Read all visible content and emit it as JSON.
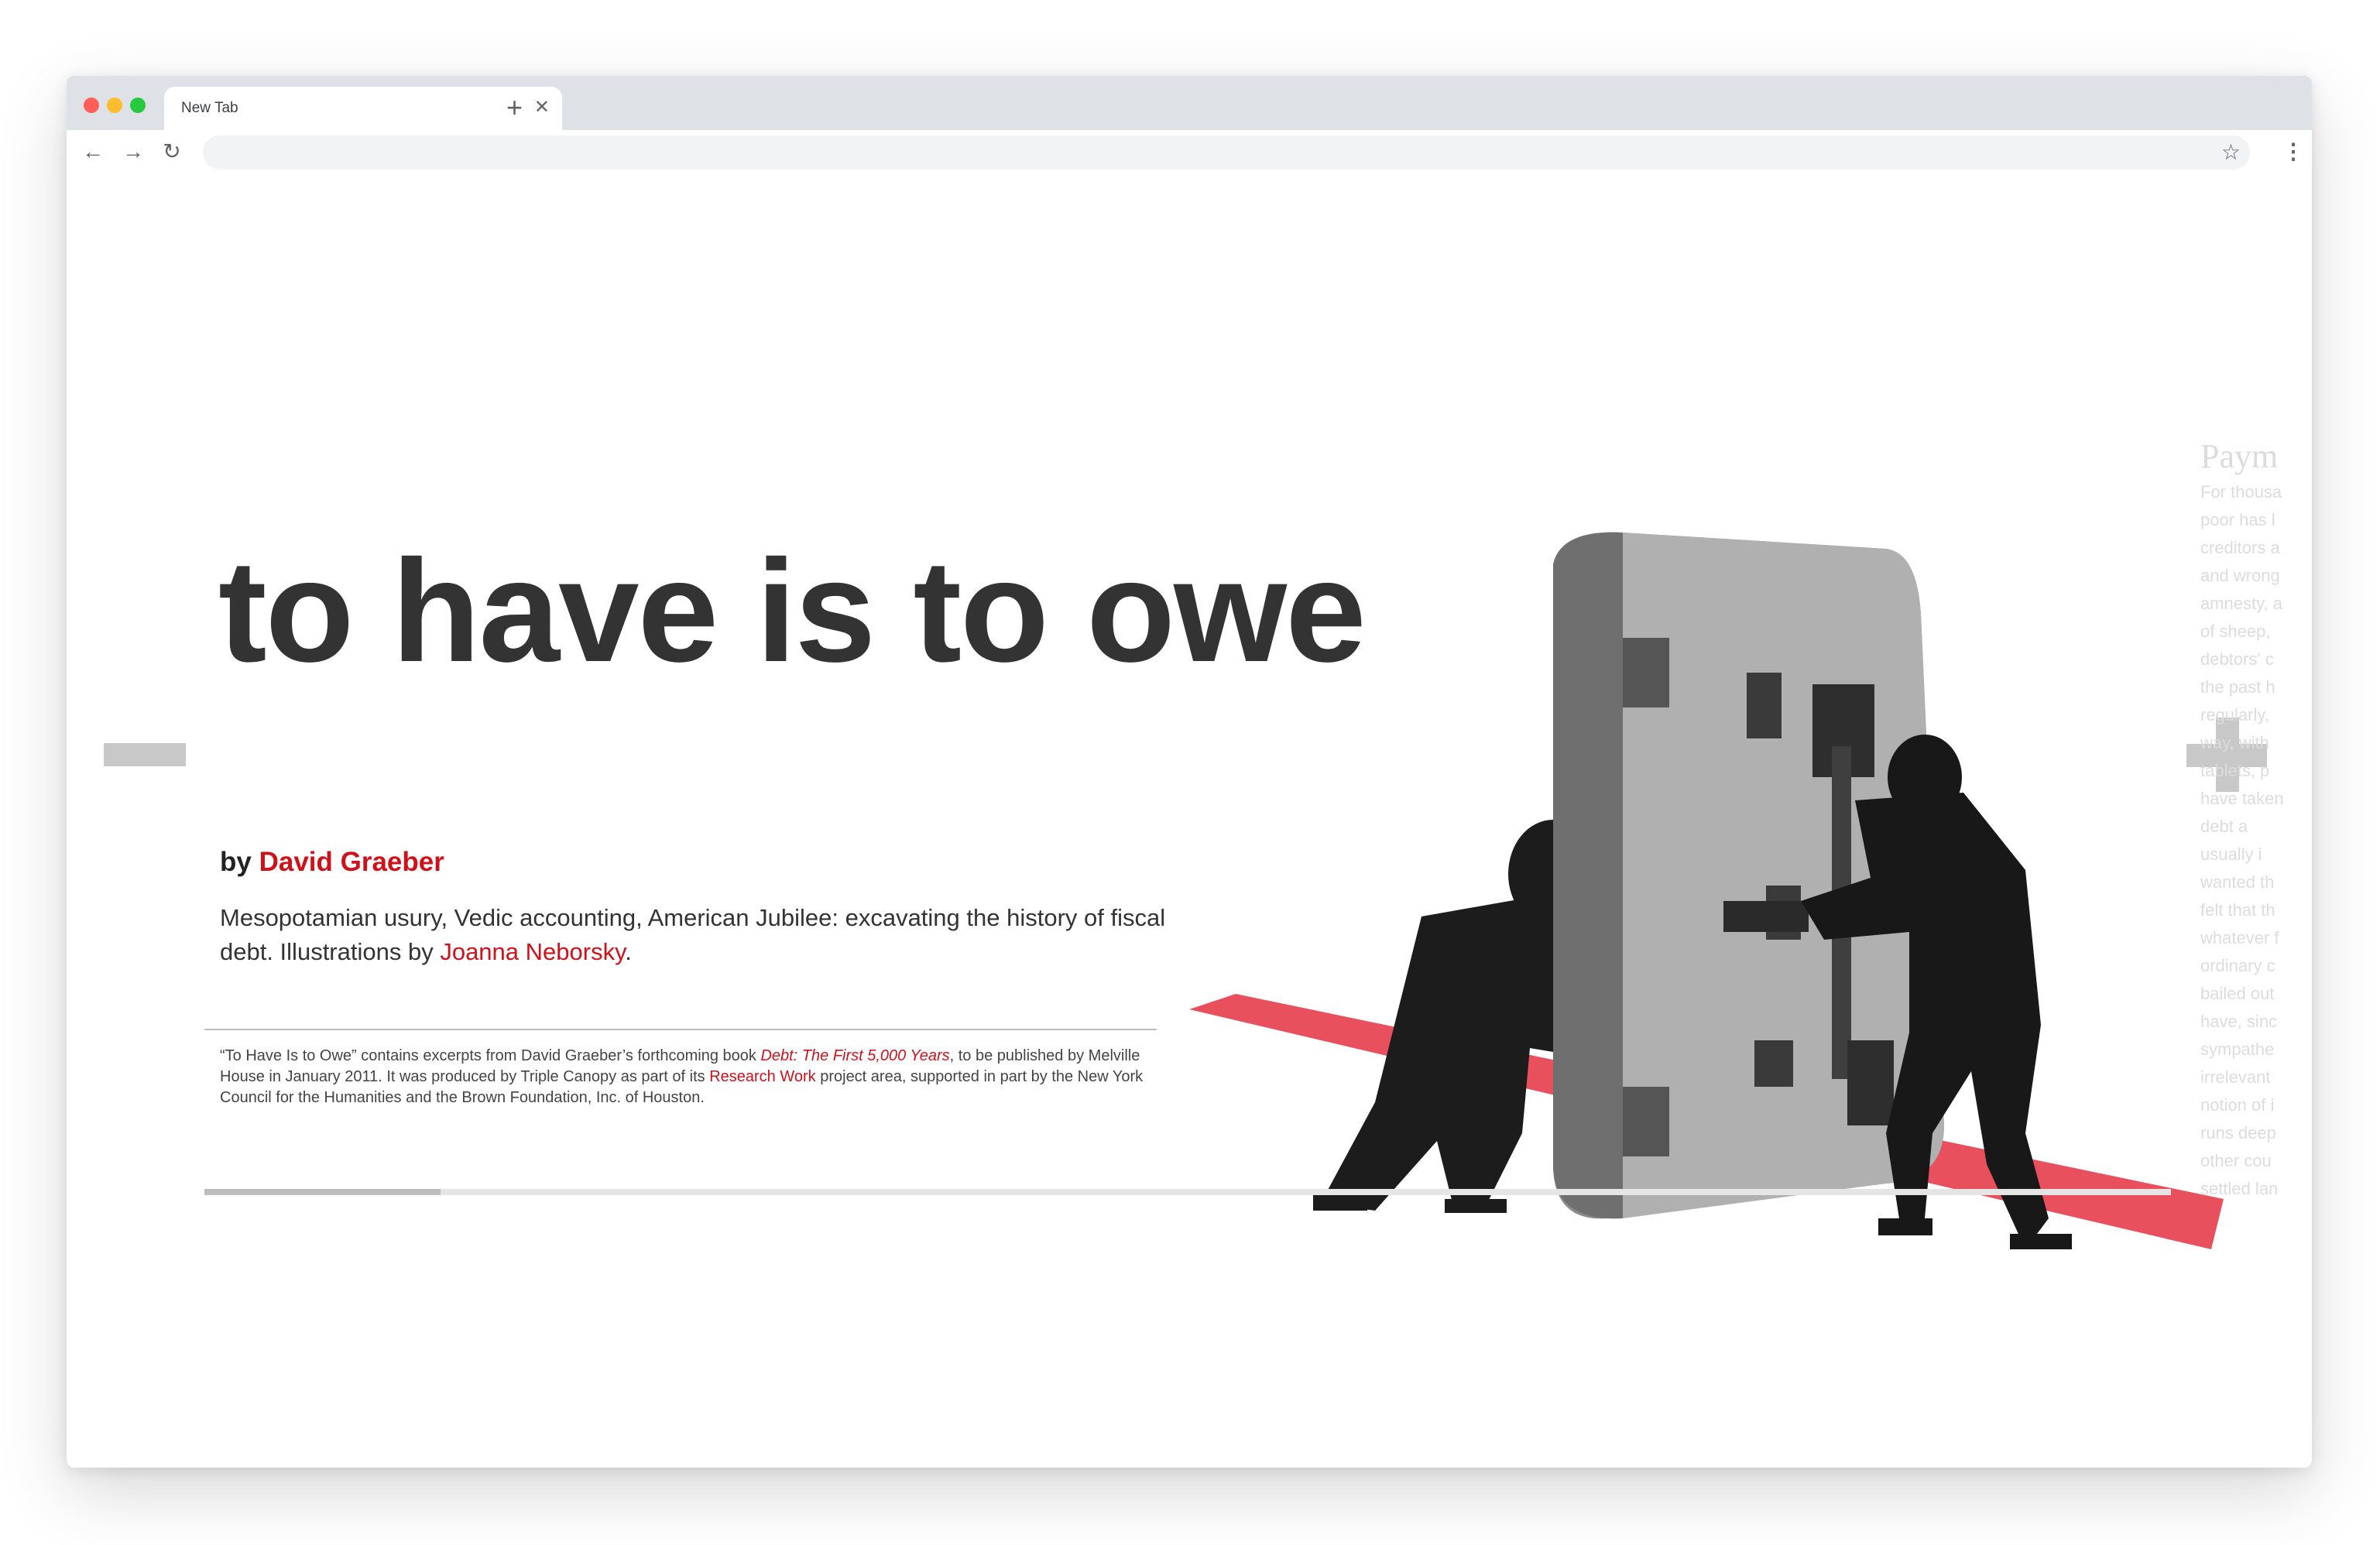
{
  "browser": {
    "tab_title": "New Tab",
    "tab_close_icon": "close-icon",
    "new_tab_icon": "plus-icon",
    "nav_icons": [
      "back-arrow-icon",
      "forward-arrow-icon",
      "reload-icon"
    ],
    "url": "",
    "bookmark_icon": "star-icon",
    "menu_icon": "kebab-menu-icon"
  },
  "article": {
    "headline": "to have is to owe",
    "byline_prefix": "by ",
    "author": "David Graeber",
    "dek_text": "Mesopotamian usury, Vedic accounting, American Jubilee: excavating the history of fiscal debt. Illustrations by ",
    "illustrator": "Joanna Neborsky",
    "dek_end": ".",
    "footnote": {
      "part1": "“To Have Is to Owe” contains excerpts from David Graeber’s forthcoming book ",
      "book_title": "Debt: The First 5,000 Years",
      "part2": ", to be published by Melville House in January 2011. It was produced by Triple Canopy as part of its ",
      "project_link": "Research Work",
      "part3": " project area, supported in part by the New York Council for the Humanities and the Brown Foundation, Inc. of Houston."
    }
  },
  "controls": {
    "prev_icon": "minus-icon",
    "next_icon": "plus-icon",
    "scroll_progress": 0.12
  },
  "illustration": {
    "description_icon": "vault-door-collage-illustration"
  },
  "next_panel": {
    "title": "Paym",
    "lines": [
      "For thousa",
      "poor has l",
      "creditors a",
      "and wrong",
      "amnesty, a",
      "of sheep,",
      "debtors' c",
      "the past h",
      "regularly,",
      "way, with",
      "tablets, p",
      "have taken",
      "debt a",
      "usually i",
      "wanted th",
      "felt that th",
      "whatever f",
      "ordinary c",
      "bailed out",
      "have, sinc",
      "sympathe",
      "irrelevant",
      "notion of i",
      "runs deep",
      "other cou",
      "settled lan"
    ]
  },
  "colors": {
    "accent_red": "#d0111a",
    "headline": "#333333",
    "control_gray": "#c8c8c8",
    "floor_pink": "#e8505e"
  }
}
